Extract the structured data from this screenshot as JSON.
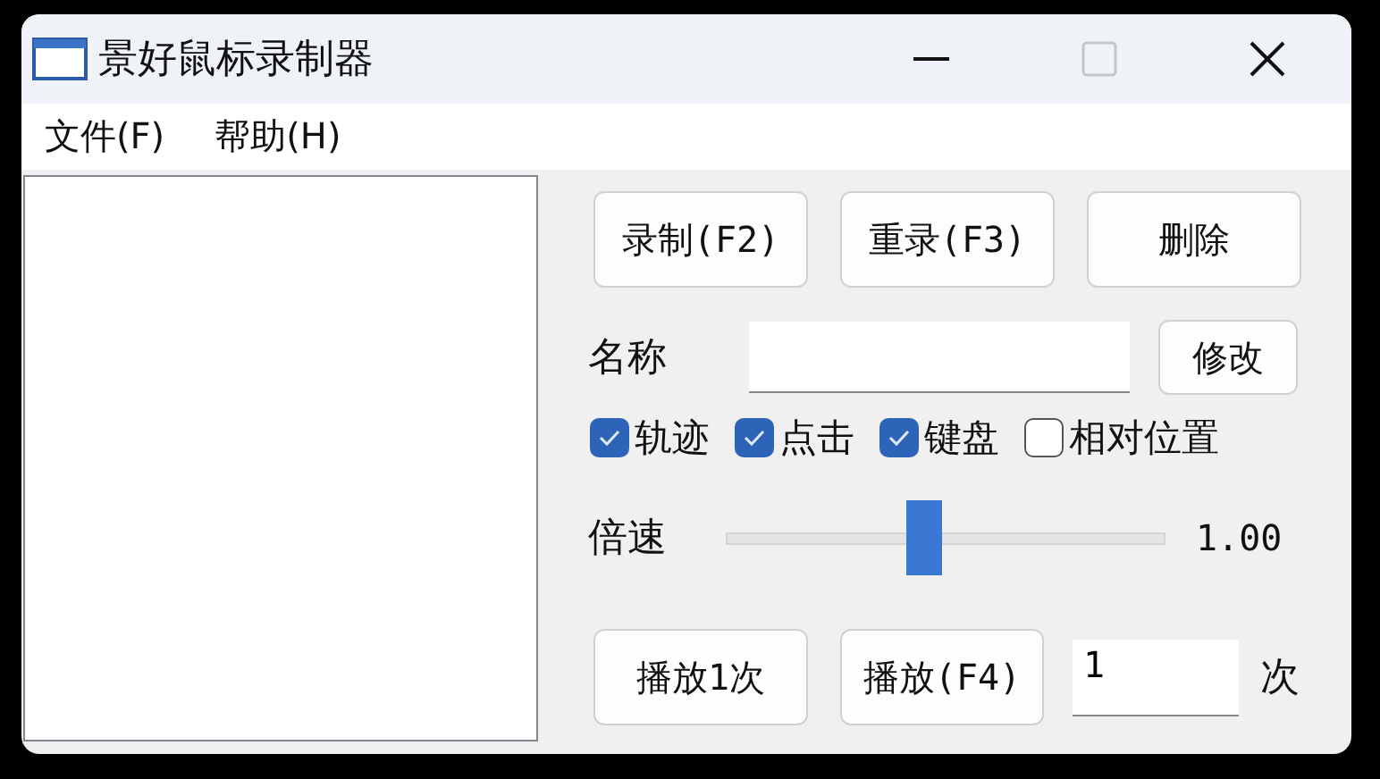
{
  "window": {
    "title": "景好鼠标录制器"
  },
  "menu": [
    {
      "label": "文件(F)"
    },
    {
      "label": "帮助(H)"
    }
  ],
  "record_buttons": [
    "录制(F2)",
    "重录(F3)",
    "删除"
  ],
  "name": {
    "label": "名称",
    "button": "修改"
  },
  "options": [
    {
      "label": "轨迹",
      "checked": true
    },
    {
      "label": "点击",
      "checked": true
    },
    {
      "label": "键盘",
      "checked": true
    },
    {
      "label": "相对位置",
      "checked": false
    }
  ],
  "speed": {
    "label": "倍速",
    "level": 0.45,
    "reading": "1.00"
  },
  "play": {
    "buttons": [
      "播放1次",
      "播放(F4)"
    ],
    "count": "1",
    "unit": "次"
  }
}
